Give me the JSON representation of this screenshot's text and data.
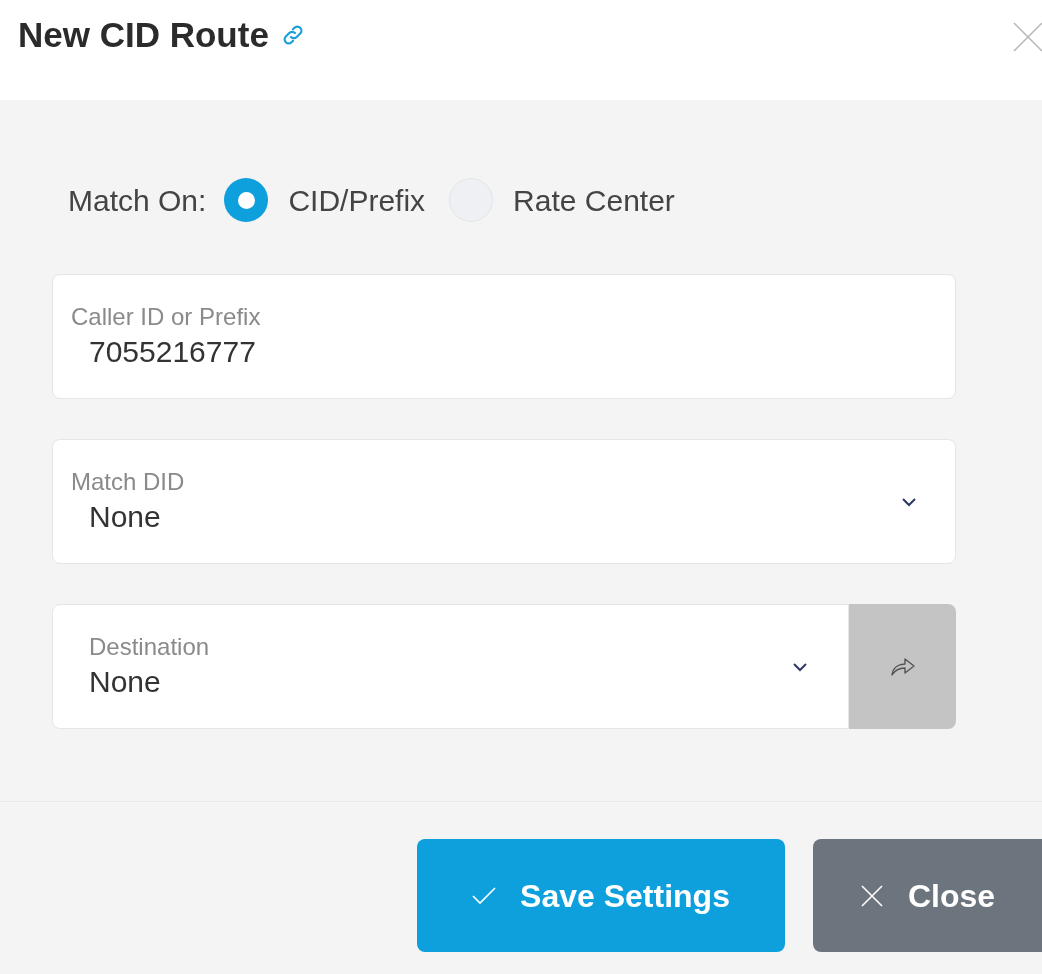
{
  "dialog": {
    "title": "New CID Route"
  },
  "match_on": {
    "label": "Match On:",
    "options": [
      {
        "label": "CID/Prefix",
        "selected": true
      },
      {
        "label": "Rate Center",
        "selected": false
      }
    ]
  },
  "fields": [
    {
      "kind": "text",
      "label": "Caller ID or Prefix",
      "value": "7055216777"
    },
    {
      "kind": "select",
      "label": "Match DID",
      "value": "None"
    },
    {
      "kind": "select-go",
      "label": "Destination",
      "value": "None"
    }
  ],
  "buttons": [
    {
      "kind": "save",
      "label": "Save Settings"
    },
    {
      "kind": "close",
      "label": "Close"
    }
  ]
}
